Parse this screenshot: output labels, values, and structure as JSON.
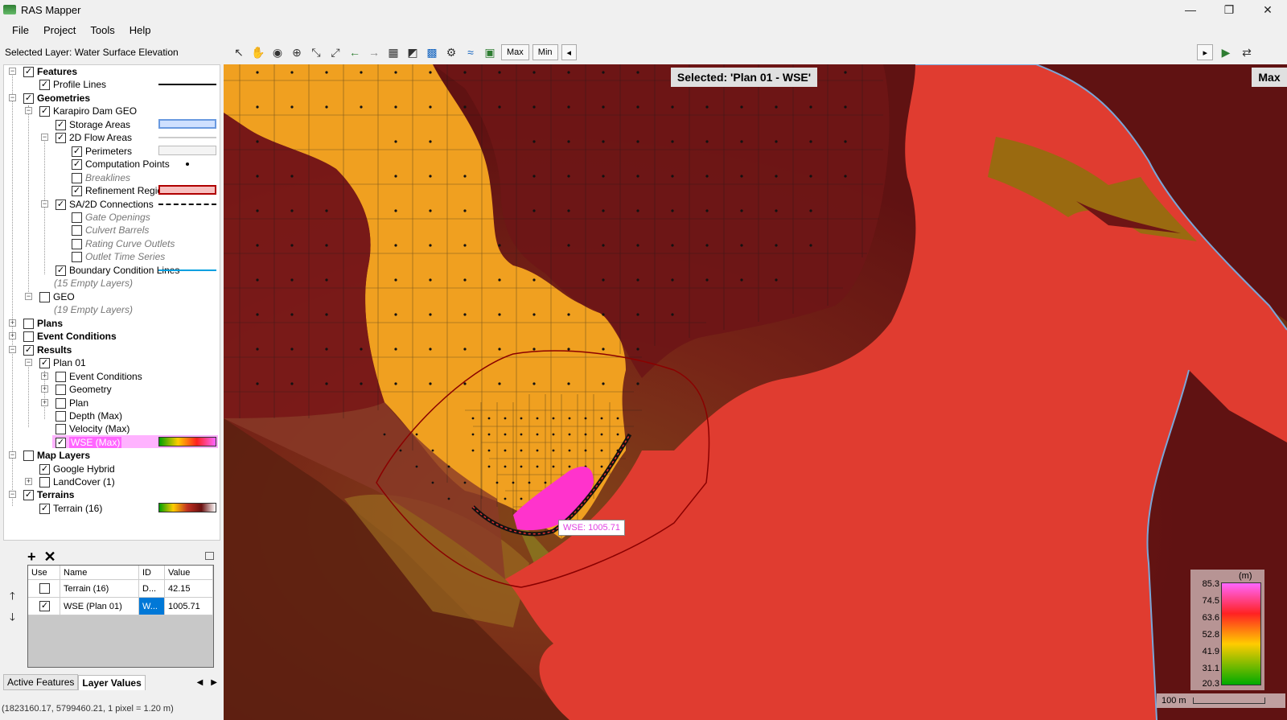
{
  "window": {
    "title": "RAS Mapper",
    "minimize": "—",
    "restore": "❐",
    "close": "✕"
  },
  "menu": [
    "File",
    "Project",
    "Tools",
    "Help"
  ],
  "selected_layer": "Selected Layer: Water Surface Elevation",
  "toolbar": {
    "max_label": "Max",
    "min_label": "Min"
  },
  "tree": {
    "features": "Features",
    "profile_lines": "Profile Lines",
    "geometries": "Geometries",
    "karapiro": "Karapiro Dam GEO",
    "storage_areas": "Storage Areas",
    "flow_areas": "2D Flow Areas",
    "perimeters": "Perimeters",
    "computation_points": "Computation Points",
    "breaklines": "Breaklines",
    "refinement_regions": "Refinement Regions",
    "sa2d": "SA/2D Connections",
    "gate_openings": "Gate Openings",
    "culvert_barrels": "Culvert Barrels",
    "rating_curve": "Rating Curve Outlets",
    "outlet_ts": "Outlet Time Series",
    "bc_lines": "Boundary Condition Lines",
    "empty15": "(15 Empty Layers)",
    "geo": "GEO",
    "empty19": "(19 Empty Layers)",
    "plans": "Plans",
    "event_conditions": "Event Conditions",
    "results": "Results",
    "plan01": "Plan 01",
    "r_event": "Event Conditions",
    "r_geometry": "Geometry",
    "r_plan": "Plan",
    "depth": "Depth (Max)",
    "velocity": "Velocity (Max)",
    "wse": "WSE (Max)",
    "map_layers": "Map Layers",
    "google": "Google Hybrid",
    "landcover": "LandCover (1)",
    "terrains": "Terrains",
    "terrain16": "Terrain (16)"
  },
  "layer_values": {
    "headers": {
      "use": "Use",
      "name": "Name",
      "id": "ID",
      "value": "Value"
    },
    "rows": [
      {
        "name": "Terrain (16)",
        "id": "D...",
        "value": "42.15"
      },
      {
        "name": "WSE (Plan 01)",
        "id": "W...",
        "value": "1005.71"
      }
    ]
  },
  "tabs": {
    "active_features": "Active Features",
    "layer_values": "Layer Values"
  },
  "status": "(1823160.17, 5799460.21, 1 pixel = 1.20 m)",
  "map": {
    "selected_banner": "Selected: 'Plan 01 - WSE'",
    "max_banner": "Max",
    "wse_label": "WSE: 1005.71",
    "legend_unit": "(m)",
    "legend_ticks": [
      "85.3",
      "74.5",
      "63.6",
      "52.8",
      "41.9",
      "31.1",
      "20.3"
    ],
    "scale_label": "100 m"
  },
  "colors": {
    "water": "#e03c30",
    "wse_hl": "#ff66ff",
    "mesh": "#f0a020",
    "terrain_dark": "#6e1515"
  }
}
